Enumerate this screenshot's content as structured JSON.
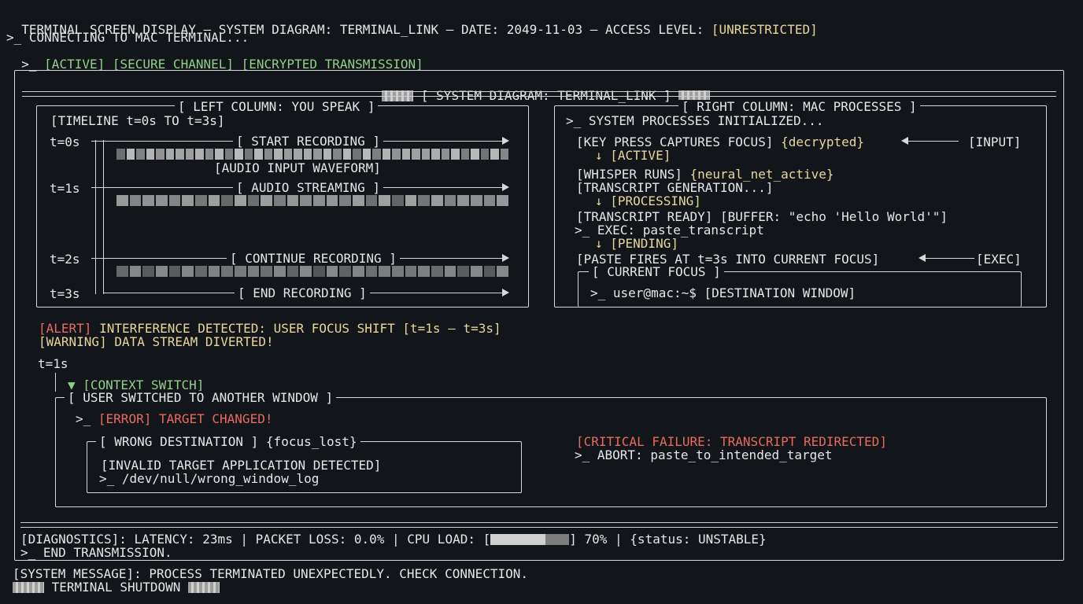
{
  "header": {
    "title_prefix": "TERMINAL SCREEN DISPLAY – SYSTEM DIAGRAM: TERMINAL_LINK – DATE: 2049-11-03 – ACCESS LEVEL: ",
    "access_level": "[UNRESTRICTED]",
    "connect_line": ">_ CONNECTING TO MAC TERMINAL...",
    "status_prompt": ">_ ",
    "status_tags": "[ACTIVE] [SECURE CHANNEL] [ENCRYPTED TRANSMISSION]"
  },
  "diagram": {
    "title": "[ SYSTEM DIAGRAM: TERMINAL_LINK ]",
    "left": {
      "legend": "[ LEFT COLUMN: YOU SPEAK ]",
      "timeline": "[TIMELINE t=0s TO t=3s]",
      "t0": "t=0s",
      "t1": "t=1s",
      "t2": "t=2s",
      "t3": "t=3s",
      "start_recording": "[ START RECORDING ]",
      "audio_waveform": "[AUDIO INPUT WAVEFORM]",
      "audio_streaming": "[ AUDIO STREAMING ]",
      "continue_recording": "[ CONTINUE RECORDING ]",
      "end_recording": "[ END RECORDING ]"
    },
    "right": {
      "legend": "[ RIGHT COLUMN: MAC PROCESSES ]",
      "init": ">_ SYSTEM PROCESSES INITIALIZED...",
      "keypress": "[KEY PRESS CAPTURES FOCUS] ",
      "decrypted": "{decrypted}",
      "input_tag": "[INPUT]",
      "active": "↓ [ACTIVE]",
      "whisper": "[WHISPER RUNS] ",
      "neural": "{neural_net_active}",
      "transcript_gen": "[TRANSCRIPT GENERATION...]",
      "processing": "↓ [PROCESSING]",
      "transcript_ready": "[TRANSCRIPT READY] [BUFFER: \"echo 'Hello World'\"]",
      "exec_line": ">_ EXEC: paste_transcript",
      "pending": "↓ [PENDING]",
      "paste_fires": "[PASTE FIRES AT t=3s INTO CURRENT FOCUS]",
      "exec_tag": "[EXEC]",
      "focus_legend": "[ CURRENT FOCUS ]",
      "focus_line": ">_ user@mac:~$ [DESTINATION WINDOW]"
    },
    "alert": {
      "alert_tag": "[ALERT]",
      "alert_text": " INTERFERENCE DETECTED: USER FOCUS SHIFT [t=1s – t=3s]",
      "warning": "[WARNING] DATA STREAM DIVERTED!"
    },
    "context": {
      "t1": "t=1s",
      "switch": "▼ [CONTEXT SWITCH]",
      "legend": "[ USER SWITCHED TO ANOTHER WINDOW ]",
      "error_prompt": ">_ ",
      "error": "[ERROR] TARGET CHANGED!",
      "wrong_legend": "[ WRONG DESTINATION ] {focus_lost}",
      "invalid": "[INVALID TARGET APPLICATION DETECTED]",
      "devnull": ">_ /dev/null/wrong_window_log",
      "critical": "[CRITICAL FAILURE: TRANSCRIPT REDIRECTED]",
      "abort": ">_ ABORT: paste_to_intended_target"
    },
    "diagnostics": {
      "prefix": "[DIAGNOSTICS]: LATENCY: 23ms | PACKET LOSS: 0.0% | CPU LOAD: [",
      "cpu_load": 0.7,
      "suffix": "] 70% | {status: UNSTABLE}",
      "end": ">_ END TRANSMISSION."
    }
  },
  "footer": {
    "message": "[SYSTEM MESSAGE]: PROCESS TERMINATED UNEXPECTEDLY. CHECK CONNECTION.",
    "shutdown": "TERMINAL SHUTDOWN"
  }
}
